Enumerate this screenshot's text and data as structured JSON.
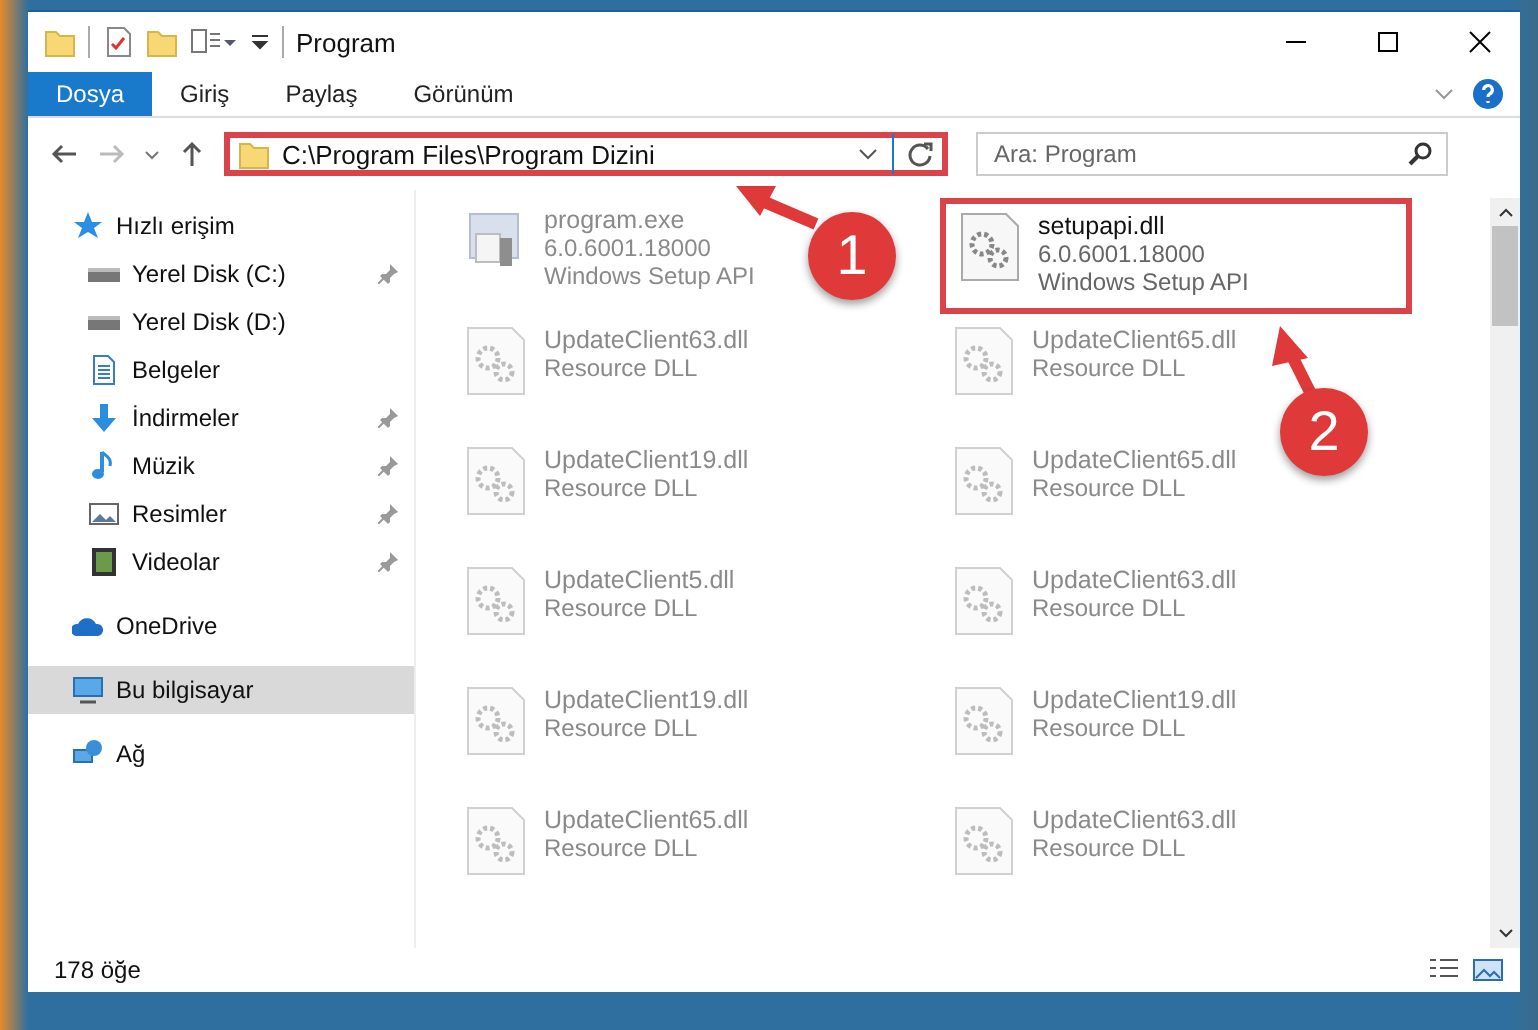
{
  "window": {
    "title": "Program"
  },
  "ribbon_tabs": [
    {
      "label": "Dosya",
      "selected": true
    },
    {
      "label": "Giriş",
      "selected": false
    },
    {
      "label": "Paylaş",
      "selected": false
    },
    {
      "label": "Görünüm",
      "selected": false
    }
  ],
  "address_bar": {
    "path": "C:\\Program Files\\Program Dizini",
    "highlighted": true
  },
  "search": {
    "placeholder": "Ara: Program"
  },
  "sidebar": {
    "items": [
      {
        "label": "Hızlı erişim",
        "kind": "star",
        "selected": false,
        "children": [
          {
            "label": "Yerel Disk (C:)",
            "kind": "drive",
            "pinned": true,
            "selected": false
          },
          {
            "label": "Yerel Disk (D:)",
            "kind": "drive",
            "pinned": false,
            "selected": false
          },
          {
            "label": "Belgeler",
            "kind": "document",
            "pinned": false,
            "selected": false
          },
          {
            "label": "İndirmeler",
            "kind": "download",
            "pinned": true,
            "selected": false
          },
          {
            "label": "Müzik",
            "kind": "music",
            "pinned": true,
            "selected": false
          },
          {
            "label": "Resimler",
            "kind": "picture",
            "pinned": true,
            "selected": false
          },
          {
            "label": "Videolar",
            "kind": "video",
            "pinned": true,
            "selected": false
          }
        ]
      },
      {
        "label": "OneDrive",
        "kind": "cloud",
        "selected": false
      },
      {
        "label": "Bu bilgisayar",
        "kind": "computer",
        "selected": true
      },
      {
        "label": "Ağ",
        "kind": "network",
        "selected": false
      }
    ]
  },
  "files": [
    {
      "name": "program.exe",
      "kind": "exe",
      "details": [
        "6.0.6001.18000",
        "Windows Setup API"
      ],
      "dimmed": true,
      "highlighted": false
    },
    {
      "name": "setupapi.dll",
      "kind": "dll",
      "details": [
        "6.0.6001.18000",
        "Windows Setup API"
      ],
      "dimmed": false,
      "highlighted": true
    },
    {
      "name": "UpdateClient63.dll",
      "kind": "dll",
      "details": [
        "Resource DLL"
      ],
      "dimmed": true,
      "highlighted": false
    },
    {
      "name": "UpdateClient65.dll",
      "kind": "dll",
      "details": [
        "Resource DLL"
      ],
      "dimmed": true,
      "highlighted": false
    },
    {
      "name": "UpdateClient19.dll",
      "kind": "dll",
      "details": [
        "Resource DLL"
      ],
      "dimmed": true,
      "highlighted": false
    },
    {
      "name": "UpdateClient65.dll",
      "kind": "dll",
      "details": [
        "Resource DLL"
      ],
      "dimmed": true,
      "highlighted": false
    },
    {
      "name": "UpdateClient5.dll",
      "kind": "dll",
      "details": [
        "Resource DLL"
      ],
      "dimmed": true,
      "highlighted": false
    },
    {
      "name": "UpdateClient63.dll",
      "kind": "dll",
      "details": [
        "Resource DLL"
      ],
      "dimmed": true,
      "highlighted": false
    },
    {
      "name": "UpdateClient19.dll",
      "kind": "dll",
      "details": [
        "Resource DLL"
      ],
      "dimmed": true,
      "highlighted": false
    },
    {
      "name": "UpdateClient19.dll",
      "kind": "dll",
      "details": [
        "Resource DLL"
      ],
      "dimmed": true,
      "highlighted": false
    },
    {
      "name": "UpdateClient65.dll",
      "kind": "dll",
      "details": [
        "Resource DLL"
      ],
      "dimmed": true,
      "highlighted": false
    },
    {
      "name": "UpdateClient63.dll",
      "kind": "dll",
      "details": [
        "Resource DLL"
      ],
      "dimmed": true,
      "highlighted": false
    }
  ],
  "callouts": [
    {
      "label": "1"
    },
    {
      "label": "2"
    }
  ],
  "status_bar": {
    "count": "178 öğe"
  }
}
